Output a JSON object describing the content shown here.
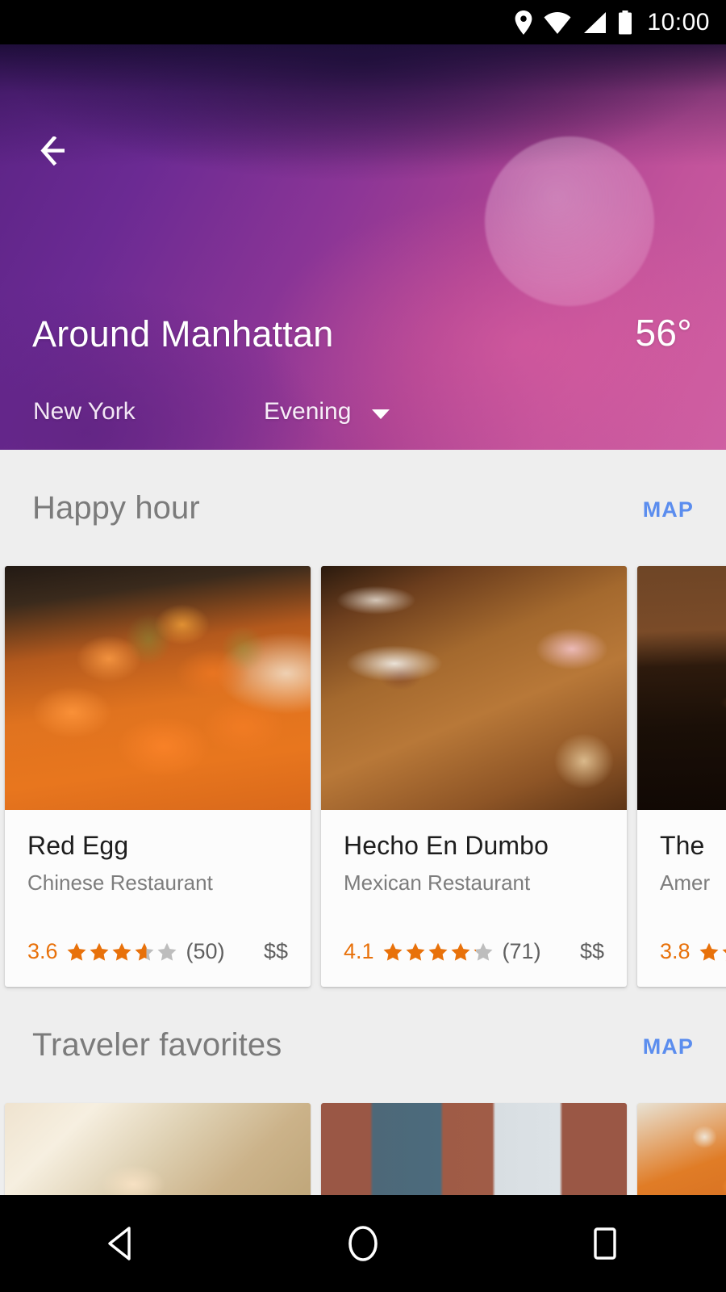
{
  "status_bar": {
    "time": "10:00",
    "icons": [
      "location-pin-icon",
      "wifi-icon",
      "cell-signal-icon",
      "battery-icon"
    ]
  },
  "header": {
    "back_label": "back-arrow-icon",
    "title": "Around Manhattan",
    "temperature": "56°",
    "city": "New York",
    "time_of_day": "Evening",
    "dropdown_icon": "chevron-down-icon",
    "gradient_start": "#5a2384",
    "gradient_end": "#cf5fa2",
    "sun_color": "#f3d8ee"
  },
  "sections": [
    {
      "title": "Happy hour",
      "map_label": "MAP",
      "cards": [
        {
          "name": "Red Egg",
          "category": "Chinese Restaurant",
          "rating": "3.6",
          "rating_value": 3.6,
          "reviews": "(50)",
          "price": "$$",
          "photo": "orange-sesame-chicken-plate"
        },
        {
          "name": "Hecho En Dumbo",
          "category": "Mexican Restaurant",
          "rating": "4.1",
          "rating_value": 4.1,
          "reviews": "(71)",
          "price": "$$",
          "photo": "tacos-cocktail-wood-table"
        },
        {
          "name": "The",
          "category": "Amer",
          "rating": "3.8",
          "rating_value": 3.8,
          "reviews": "",
          "price": "",
          "photo": "dark-bar-interior"
        }
      ]
    },
    {
      "title": "Traveler favorites",
      "map_label": "MAP",
      "cards": [
        {
          "photo": "cream-dessert-with-mint"
        },
        {
          "photo": "brick-building-windows"
        },
        {
          "photo": "orange-food-closeup"
        }
      ]
    }
  ],
  "nav_bar": {
    "back": "nav-back-icon",
    "home": "nav-home-icon",
    "recents": "nav-recents-icon"
  },
  "colors": {
    "accent_blue": "#5b8dee",
    "star_filled": "#e8710a",
    "star_empty": "#bdbdbd",
    "section_title": "#7b7b7b",
    "page_background": "#eeeeee"
  }
}
